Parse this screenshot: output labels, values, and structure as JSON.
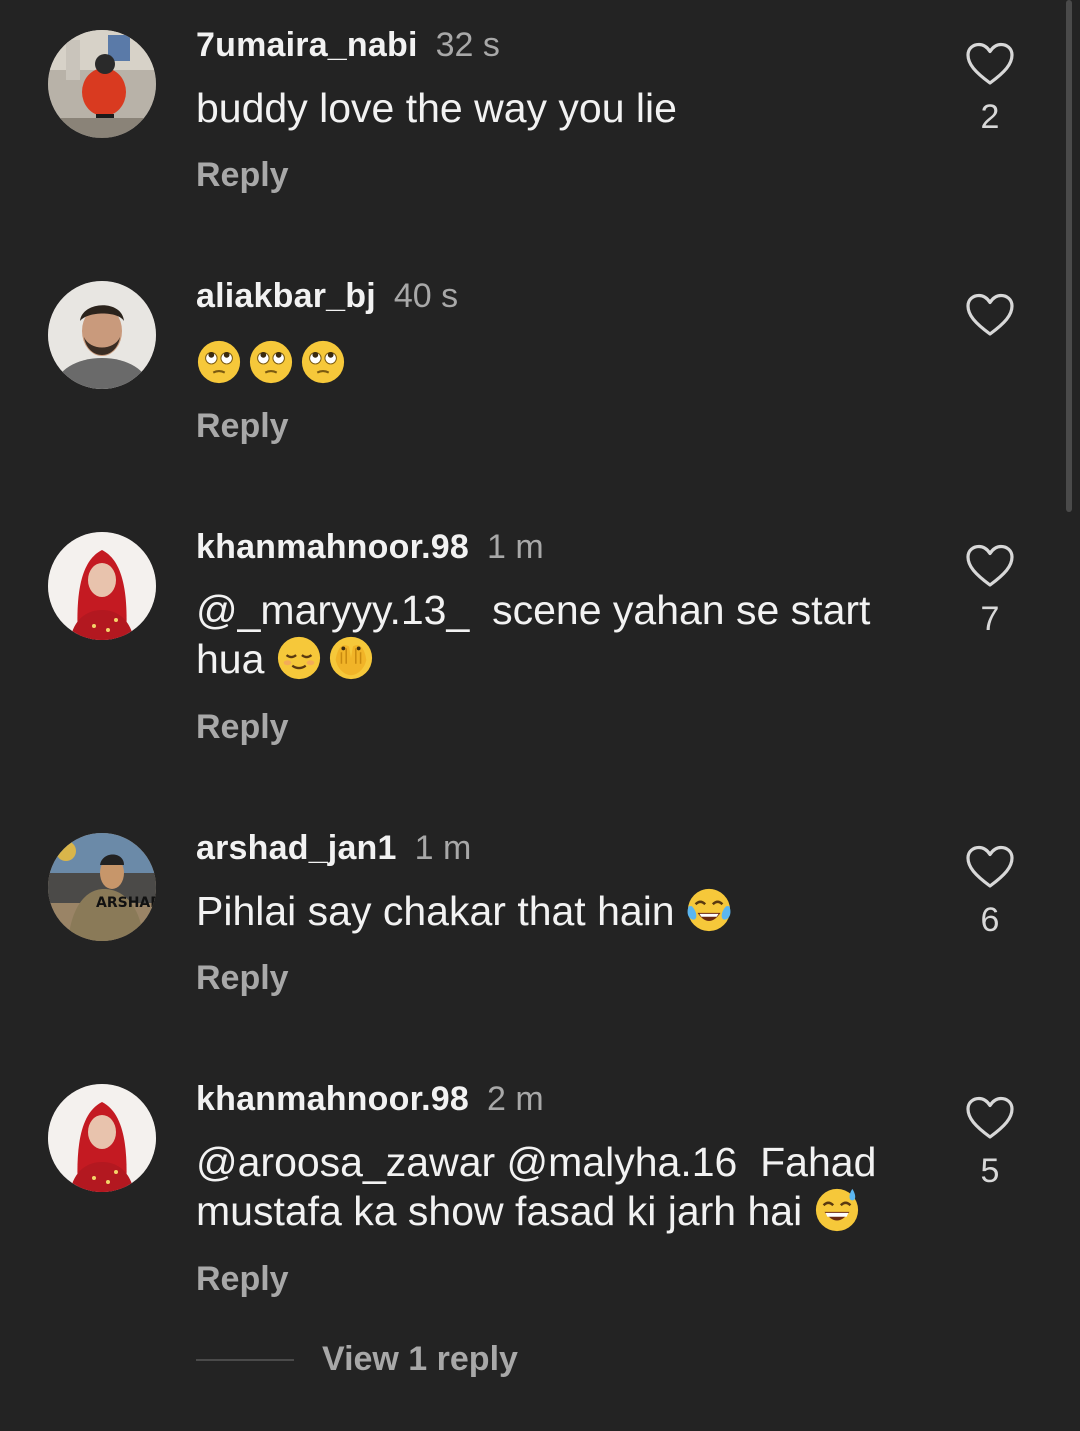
{
  "comments": [
    {
      "username": "7umaira_nabi",
      "time": "32 s",
      "text": "buddy love the way you lie",
      "mention": "",
      "emojis": [],
      "reply_label": "Reply",
      "likes": "2"
    },
    {
      "username": "aliakbar_bj",
      "time": "40 s",
      "text": "",
      "mention": "",
      "emojis": [
        "face-with-rolling-eyes",
        "face-with-rolling-eyes",
        "face-with-rolling-eyes"
      ],
      "reply_label": "Reply",
      "likes": ""
    },
    {
      "username": "khanmahnoor.98",
      "time": "1 m",
      "mention": "@_maryyy.13_",
      "text": "scene yahan se start hua",
      "emojis": [
        "relieved-face",
        "face-with-open-eyes-and-hand-over-mouth"
      ],
      "reply_label": "Reply",
      "likes": "7"
    },
    {
      "username": "arshad_jan1",
      "time": "1 m",
      "mention": "",
      "text": "Pihlai say chakar that hain",
      "emojis": [
        "face-with-tears-of-joy"
      ],
      "reply_label": "Reply",
      "likes": "6"
    },
    {
      "username": "khanmahnoor.98",
      "time": "2 m",
      "mention": "@aroosa_zawar @malyha.16",
      "text": "Fahad mustafa ka show fasad ki jarh hai",
      "emojis": [
        "grinning-face-with-sweat"
      ],
      "reply_label": "Reply",
      "likes": "5",
      "view_replies_label": "View 1 reply"
    }
  ],
  "avatar_label": "ARSHAD",
  "icons": {
    "like": "heart-outline-icon"
  },
  "colors": {
    "background": "#232323",
    "primary_text": "#f2f2f2",
    "secondary_text": "#a8a8a8"
  }
}
